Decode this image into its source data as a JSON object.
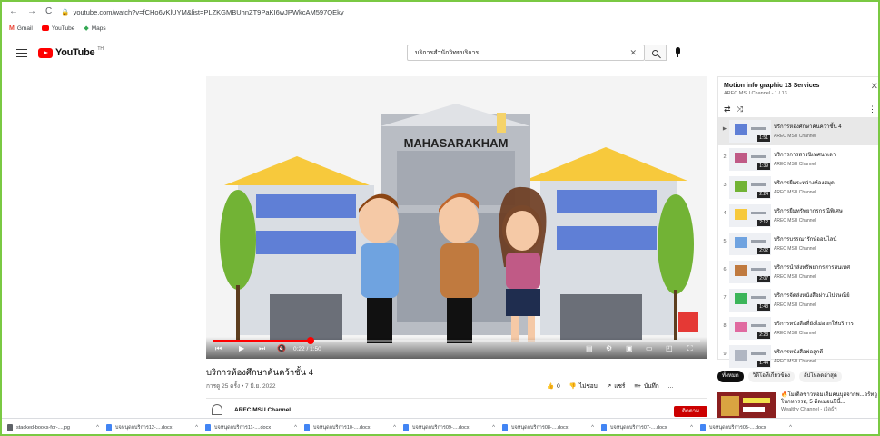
{
  "browser": {
    "url": "youtube.com/watch?v=fCHo6vKlUYM&list=PLZKGMBUhnZT9PaKI6wJPWkcAM597QEky",
    "bookmarks": [
      {
        "label": "Gmail",
        "icon": "gmail-icon"
      },
      {
        "label": "YouTube",
        "icon": "youtube-icon"
      },
      {
        "label": "Maps",
        "icon": "maps-icon"
      }
    ]
  },
  "youtube": {
    "logo_text": "YouTube",
    "logo_country": "TH",
    "search_value": "บริการสำนักวิทยบริการ"
  },
  "player": {
    "building_sign": "MAHASARAKHAM",
    "time": "0:22 / 1:50",
    "progress_fraction": 0.2
  },
  "video": {
    "title": "บริการห้องศึกษาค้นคว้าชั้น 4",
    "meta": "การดู 25 ครั้ง • 7 มิ.ย. 2022",
    "likes": "0",
    "dislike_label": "ไม่ชอบ",
    "share_label": "แชร์",
    "save_label": "บันทึก",
    "more_label": "...",
    "channel": "AREC MSU Channel",
    "subscribe_label": "ติดตาม"
  },
  "playlist": {
    "title": "Motion info graphic 13 Services",
    "subtitle": "AREC MSU Channel - 1 / 13",
    "items": [
      {
        "index": "▶",
        "title": "บริการห้องศึกษาค้นคว้าชั้น 4",
        "channel": "AREC MSU Channel",
        "duration": "1:51",
        "active": true
      },
      {
        "index": "2",
        "title": "บริการการสารนิเทศนวเลา",
        "channel": "AREC MSU Channel",
        "duration": "1:39",
        "active": false
      },
      {
        "index": "3",
        "title": "บริการยืมระหว่างห้องสมุด",
        "channel": "AREC MSU Channel",
        "duration": "2:24",
        "active": false
      },
      {
        "index": "4",
        "title": "บริการยืมทรัพยากรกรณีพิเศษ",
        "channel": "AREC MSU Channel",
        "duration": "2:12",
        "active": false
      },
      {
        "index": "5",
        "title": "บริการบรรณารักษ์ออนไลน์",
        "channel": "AREC MSU Channel",
        "duration": "2:02",
        "active": false
      },
      {
        "index": "6",
        "title": "บริการนำส่งทรัพยากรสารสนเทศ",
        "channel": "AREC MSU Channel",
        "duration": "2:07",
        "active": false
      },
      {
        "index": "7",
        "title": "บริการจัดส่งหนังสือผ่านไปรษณีย์",
        "channel": "AREC MSU Channel",
        "duration": "1:48",
        "active": false
      },
      {
        "index": "8",
        "title": "บริการหนังสือที่ยังไม่ออกให้บริการ",
        "channel": "AREC MSU Channel",
        "duration": "2:28",
        "active": false
      },
      {
        "index": "9",
        "title": "บริการหนังสือพ่อลูกดี",
        "channel": "AREC MSU Channel",
        "duration": "1:44",
        "active": false
      }
    ]
  },
  "chips": [
    "ทั้งหมด",
    "วิดีโอที่เกี่ยวข้อง",
    "อัปโหลดล่าสุด"
  ],
  "recommendation": {
    "title": "🔥โมเดิลชาวหอมเดิมคนบุสจากพ...อร์ทอูโบกหวรรอ, 5 ดีลเมอนปีนี้...",
    "channel": "Wealthy Channel - เวิลธ์ฯ"
  },
  "downloads": [
    {
      "name": "stacked-books-for-....jpg",
      "type": "image"
    },
    {
      "name": "บจหนุดกบริการ12-....docx",
      "type": "doc"
    },
    {
      "name": "บจหนุดกบริการ11-....docx",
      "type": "doc"
    },
    {
      "name": "บจหนุดกบริการ10-....docx",
      "type": "doc"
    },
    {
      "name": "บจหนุดกบริการ09-....docx",
      "type": "doc"
    },
    {
      "name": "บจหนุดกบริการ08-....docx",
      "type": "doc"
    },
    {
      "name": "บจหนุดกบริการ07-....docx",
      "type": "doc"
    },
    {
      "name": "บจหนุดกบริการ05-....docx",
      "type": "doc"
    }
  ],
  "colors": {
    "accent_red": "#ff0000",
    "screen_border": "#7ac943",
    "subscribe": "#cc0000"
  }
}
